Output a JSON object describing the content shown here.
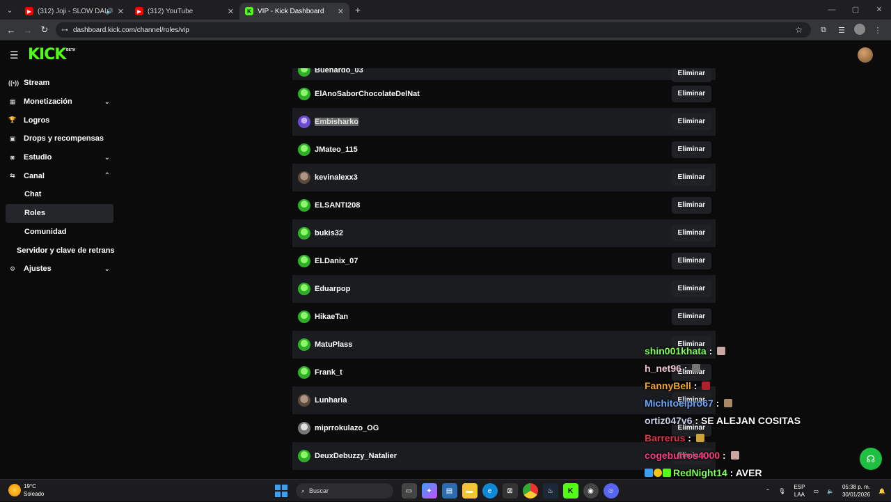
{
  "browser": {
    "tabs": [
      {
        "title": "(312) Joji - SLOW DANCING",
        "icon": "youtube-icon",
        "audio": true
      },
      {
        "title": "(312) YouTube",
        "icon": "youtube-icon",
        "audio": false
      },
      {
        "title": "VIP - Kick Dashboard",
        "icon": "kick-icon",
        "audio": false
      }
    ],
    "url": "dashboard.kick.com/channel/roles/vip"
  },
  "header": {
    "logo": "KICK",
    "badge": "BETA"
  },
  "sidebar": {
    "items": [
      {
        "label": "Stream",
        "icon": "broadcast-icon"
      },
      {
        "label": "Monetización",
        "icon": "chart-icon",
        "chevron": "down"
      },
      {
        "label": "Logros",
        "icon": "trophy-icon"
      },
      {
        "label": "Drops y recompensas",
        "icon": "gift-icon"
      },
      {
        "label": "Estudio",
        "icon": "camera-icon",
        "chevron": "down"
      },
      {
        "label": "Canal",
        "icon": "link-icon",
        "chevron": "up"
      },
      {
        "label": "Chat",
        "sub": true
      },
      {
        "label": "Roles",
        "sub": true,
        "active": true
      },
      {
        "label": "Comunidad",
        "sub": true
      },
      {
        "label": "Servidor y clave de retrans"
      },
      {
        "label": "Ajustes",
        "icon": "gear-icon",
        "chevron": "down"
      }
    ]
  },
  "vip_list": {
    "remove_label": "Eliminar",
    "rows": [
      {
        "name": "Buenardo_03"
      },
      {
        "name": "ElAnoSaborChocolateDelNat",
        "avatar": "green"
      },
      {
        "name": "Embisharko",
        "avatar": "purple",
        "selected": true
      },
      {
        "name": "JMateo_115",
        "avatar": "green"
      },
      {
        "name": "kevinalexx3",
        "avatar": "photo"
      },
      {
        "name": "ELSANTI208",
        "avatar": "green"
      },
      {
        "name": "bukis32",
        "avatar": "green"
      },
      {
        "name": "ELDanix_07",
        "avatar": "green"
      },
      {
        "name": "Eduarpop",
        "avatar": "green"
      },
      {
        "name": "HikaeTan",
        "avatar": "green"
      },
      {
        "name": "MatuPlass",
        "avatar": "green"
      },
      {
        "name": "Frank_t",
        "avatar": "green"
      },
      {
        "name": "Lunharia",
        "avatar": "photo"
      },
      {
        "name": "miprrokulazo_OG",
        "avatar": "grey"
      },
      {
        "name": "DeuxDebuzzy_Natalier",
        "avatar": "green"
      }
    ]
  },
  "chat_overlay": [
    {
      "user": "shin001khata",
      "color": "#7dff5a",
      "text": ""
    },
    {
      "user": "h_net96",
      "color": "#f2c9d7",
      "text": ""
    },
    {
      "user": "FannyBell",
      "color": "#f0a530",
      "text": ""
    },
    {
      "user": "Michitoelpro67",
      "color": "#6fa7ff",
      "text": ""
    },
    {
      "user": "ortiz047v6",
      "color": "#c9d1e8",
      "text": "SE ALEJAN COSITAS"
    },
    {
      "user": "Barrerus",
      "color": "#e0344c",
      "text": ""
    },
    {
      "user": "cogeburros4000",
      "color": "#ff3a7c",
      "text": ""
    },
    {
      "user": "RedNight14",
      "color": "#7dff5a",
      "text": "AVER"
    }
  ],
  "taskbar": {
    "temperature": "19°C",
    "weather": "Soleado",
    "search": "Buscar",
    "lang1": "ESP",
    "lang2": "LAA",
    "time": "05:38 p. m.",
    "date": "30/01/2026"
  }
}
